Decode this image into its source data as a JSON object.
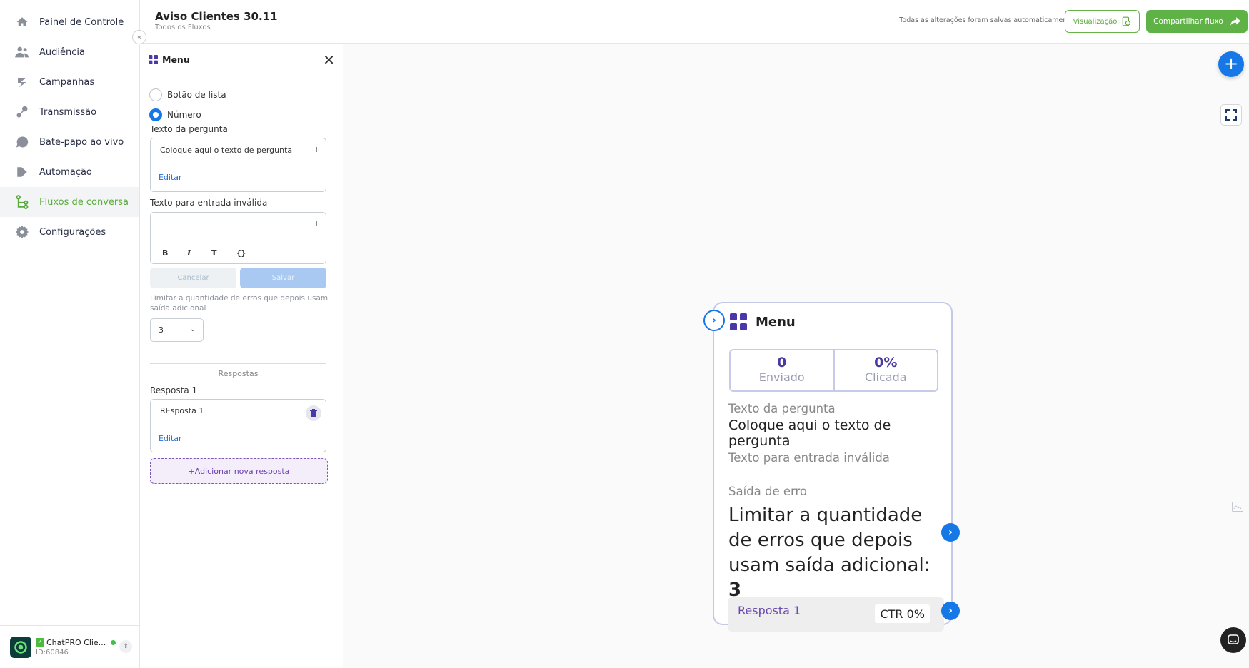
{
  "sidebar": {
    "items": [
      {
        "label": "Painel de Controle",
        "icon": "home-icon"
      },
      {
        "label": "Audiência",
        "icon": "users-icon"
      },
      {
        "label": "Campanhas",
        "icon": "campaign-icon"
      },
      {
        "label": "Transmissão",
        "icon": "broadcast-icon"
      },
      {
        "label": "Bate-papo ao vivo",
        "icon": "chat-bubble-icon"
      },
      {
        "label": "Automação",
        "icon": "automation-icon"
      },
      {
        "label": "Fluxos de conversa",
        "icon": "flow-icon"
      },
      {
        "label": "Configurações",
        "icon": "gear-icon"
      }
    ],
    "active_index": 6,
    "account": {
      "name": "ChatPRO Clie...",
      "id": "ID:60846",
      "check": "✓"
    }
  },
  "header": {
    "title": "Aviso Clientes 30.11",
    "subtitle": "Todos os Fluxos",
    "status": "Todas as alterações foram salvas automaticamente",
    "preview_label": "Visualização",
    "share_label": "Compartilhar fluxo"
  },
  "panel": {
    "title": "Menu",
    "radio_list": "Botão de lista",
    "radio_number": "Número",
    "question_label": "Texto da pergunta",
    "question_text": "Coloque aqui o texto de pergunta",
    "edit_label": "Editar",
    "invalid_label": "Texto para entrada inválida",
    "cancel_label": "Cancelar",
    "save_label": "Salvar",
    "limit_hint": "Limitar a quantidade de erros que depois usam saída adicional",
    "limit_value": "3",
    "answers_section": "Respostas",
    "answer1_label": "Resposta 1",
    "answer1_text": "REsposta 1",
    "add_answer": "+Adicionar nova resposta"
  },
  "node": {
    "title": "Menu",
    "sent_value": "0",
    "sent_label": "Enviado",
    "clicked_value": "0%",
    "clicked_label": "Clicada",
    "question_label": "Texto da pergunta",
    "question_text": "Coloque aqui o texto de pergunta",
    "invalid_label": "Texto para entrada inválida",
    "error_label": "Saída de erro",
    "error_text": "Limitar a quantidade de erros que depois usam saída adicional:",
    "error_value": "3",
    "response_label": "Resposta 1",
    "ctr": "CTR 0%"
  },
  "colors": {
    "brand_green": "#5fb246",
    "accent_blue": "#1677e6",
    "purple": "#6b3fb0"
  }
}
